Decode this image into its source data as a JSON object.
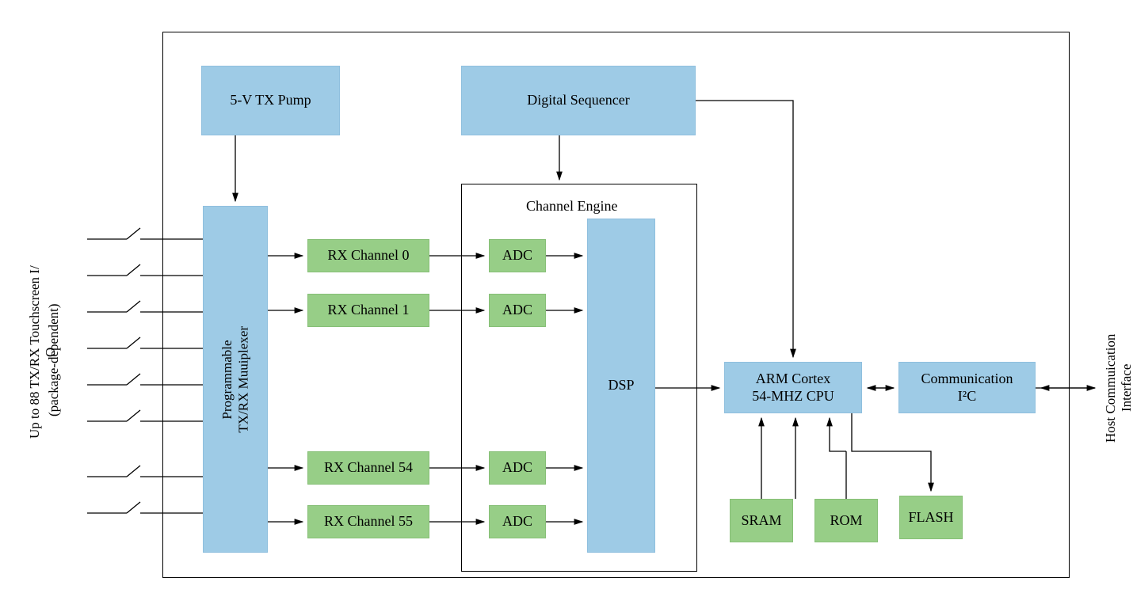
{
  "left_label_1": "Up to 88 TX/RX Touchscreen I/\nO",
  "left_label_2": "(package-dependent)",
  "right_label": "Host Commuication\nInterface",
  "outer": {},
  "blocks": {
    "tx_pump": "5-V TX Pump",
    "digital_sequencer": "Digital Sequencer",
    "mux": "Programmable\nTX/RX Muuiplexer",
    "channel_engine_title": "Channel Engine",
    "rx0": "RX Channel 0",
    "rx1": "RX Channel 1",
    "rx54": "RX Channel 54",
    "rx55": "RX Channel 55",
    "adc": "ADC",
    "dsp": "DSP",
    "arm_line1": "ARM Cortex",
    "arm_line2": "54-MHZ CPU",
    "comm_line1": "Communication",
    "comm_line2": "I²C",
    "sram": "SRAM",
    "rom": "ROM",
    "flash": "FLASH"
  }
}
